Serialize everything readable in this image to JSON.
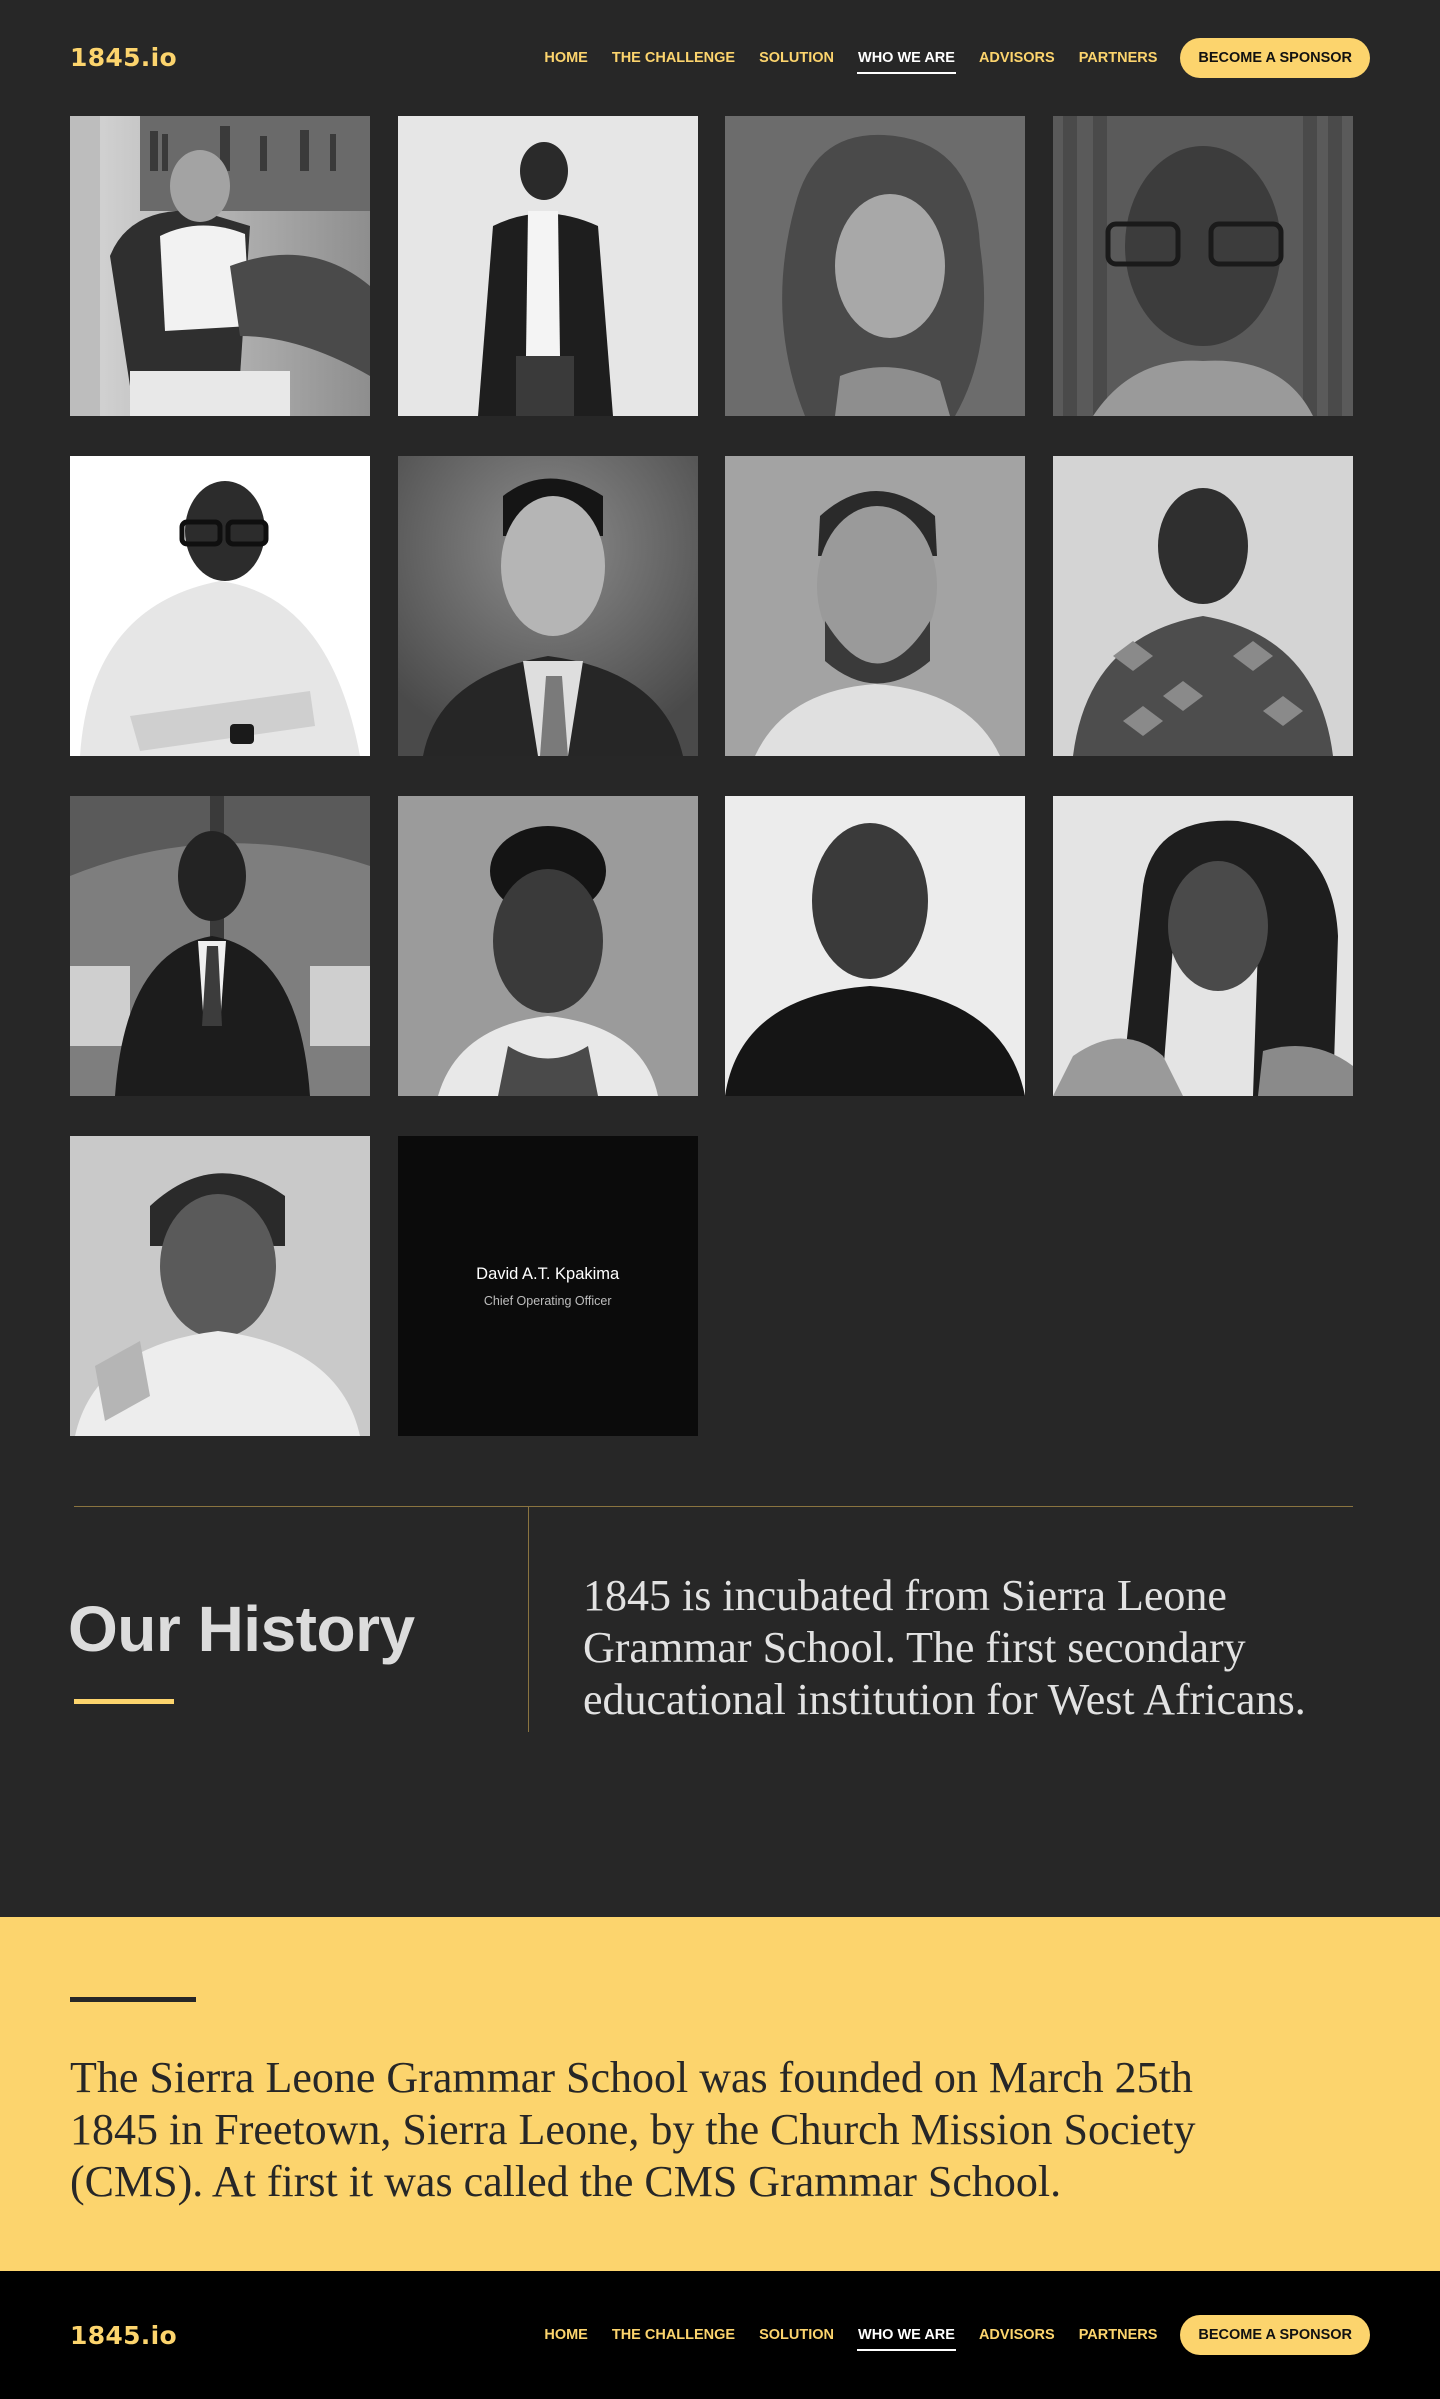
{
  "nav": {
    "logo": "1845.io",
    "items": [
      "HOME",
      "THE CHALLENGE",
      "SOLUTION",
      "WHO WE ARE",
      "ADVISORS",
      "PARTNERS"
    ],
    "active": "WHO WE ARE",
    "cta": "BECOME A SPONSOR"
  },
  "team": {
    "featured": {
      "name": "David A.T. Kpakima",
      "role": "Chief Operating Officer"
    },
    "photo_count": 13
  },
  "history": {
    "title": "Our History",
    "intro": "1845 is incubated from Sierra Leone Grammar School. The first secondary educational institution for West Africans.",
    "founding": "The Sierra Leone Grammar School was founded on March 25th 1845 in Freetown, Sierra Leone, by the Church Mission Society (CMS). At first it was called the CMS Grammar School."
  },
  "footer_nav": {
    "logo": "1845.io",
    "items": [
      "HOME",
      "THE CHALLENGE",
      "SOLUTION",
      "WHO WE ARE",
      "ADVISORS",
      "PARTNERS"
    ],
    "active": "WHO WE ARE",
    "cta": "BECOME A SPONSOR"
  },
  "colors": {
    "background": "#272727",
    "accent": "#fcd46d",
    "footer": "#000000",
    "info_tile": "#0b0b0b"
  }
}
